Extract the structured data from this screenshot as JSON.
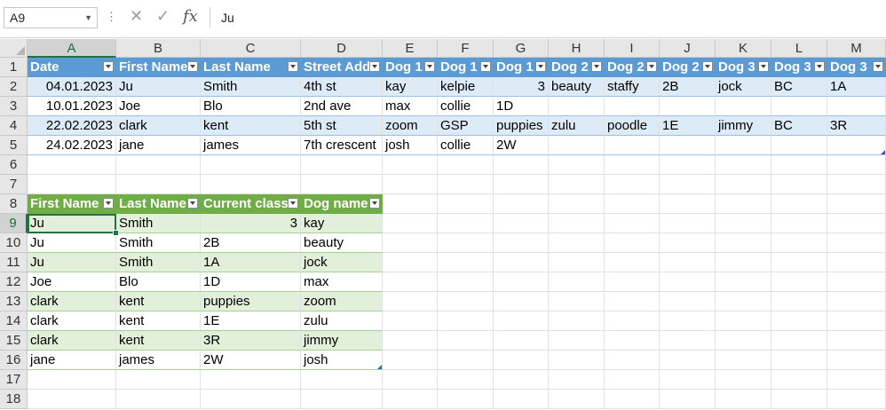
{
  "formula_bar": {
    "name_box": "A9",
    "formula": "Ju"
  },
  "columns": [
    "A",
    "B",
    "C",
    "D",
    "E",
    "F",
    "G",
    "H",
    "I",
    "J",
    "K",
    "L",
    "M"
  ],
  "rows": [
    "1",
    "2",
    "3",
    "4",
    "5",
    "6",
    "7",
    "8",
    "9",
    "10",
    "11",
    "12",
    "13",
    "14",
    "15",
    "16",
    "17",
    "18"
  ],
  "table1": {
    "headers": [
      "Date",
      "First Name",
      "Last Name",
      "Street Addr",
      "Dog 1",
      "Dog 1",
      "Dog 1",
      "Dog 2",
      "Dog 2",
      "Dog 2",
      "Dog 3",
      "Dog 3",
      "Dog 3"
    ],
    "rows": [
      [
        "04.01.2023",
        "Ju",
        "Smith",
        "4th st",
        "kay",
        "kelpie",
        "3",
        "beauty",
        "staffy",
        "2B",
        "jock",
        "BC",
        "1A"
      ],
      [
        "10.01.2023",
        "Joe",
        "Blo",
        "2nd ave",
        "max",
        "collie",
        "1D",
        "",
        "",
        "",
        "",
        "",
        ""
      ],
      [
        "22.02.2023",
        "clark",
        "kent",
        "5th st",
        "zoom",
        "GSP",
        "puppies",
        "zulu",
        "poodle",
        "1E",
        "jimmy",
        "BC",
        "3R"
      ],
      [
        "24.02.2023",
        "jane",
        "james",
        "7th crescent",
        "josh",
        "collie",
        "2W",
        "",
        "",
        "",
        "",
        "",
        ""
      ]
    ]
  },
  "table2": {
    "headers": [
      "First Name",
      "Last Name",
      "Current class",
      "Dog name"
    ],
    "rows": [
      [
        "Ju",
        "Smith",
        "3",
        "kay"
      ],
      [
        "Ju",
        "Smith",
        "2B",
        "beauty"
      ],
      [
        "Ju",
        "Smith",
        "1A",
        "jock"
      ],
      [
        "Joe",
        "Blo",
        "1D",
        "max"
      ],
      [
        "clark",
        "kent",
        "puppies",
        "zoom"
      ],
      [
        "clark",
        "kent",
        "1E",
        "zulu"
      ],
      [
        "clark",
        "kent",
        "3R",
        "jimmy"
      ],
      [
        "jane",
        "james",
        "2W",
        "josh"
      ]
    ]
  },
  "selected_cell": "A9",
  "colors": {
    "table1_header": "#5b9bd5",
    "table1_band": "#ddebf7",
    "table2_header": "#70ad47",
    "table2_band": "#e2efda",
    "selection": "#217346"
  }
}
